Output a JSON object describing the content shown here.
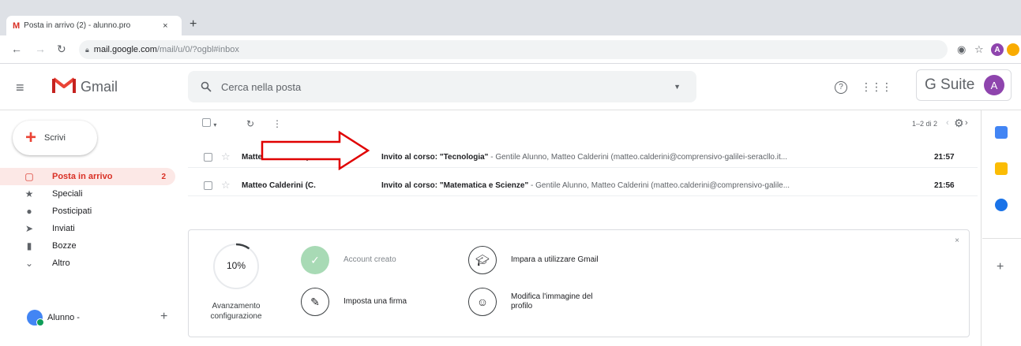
{
  "browser": {
    "tab_title": "Posta in arrivo (2) - alunno.pro",
    "tab_close": "×",
    "new_tab": "+",
    "url_host": "mail.google.com",
    "url_path": "/mail/u/0/?ogbl#inbox"
  },
  "header": {
    "app_name": "Gmail",
    "search_placeholder": "Cerca nella posta",
    "gsuite_label": "G Suite",
    "avatar_letter": "A"
  },
  "sidebar": {
    "compose_label": "Scrivi",
    "items": [
      {
        "label": "Posta in arrivo",
        "count": "2",
        "icon": "inbox-icon"
      },
      {
        "label": "Speciali",
        "icon": "star-icon"
      },
      {
        "label": "Posticipati",
        "icon": "clock-icon"
      },
      {
        "label": "Inviati",
        "icon": "send-icon"
      },
      {
        "label": "Bozze",
        "icon": "draft-icon"
      },
      {
        "label": "Altro",
        "icon": "chevron-down-icon"
      }
    ],
    "user_label": "Alunno -",
    "user_add": "+"
  },
  "list": {
    "pager": "1–2 di 2",
    "emails": [
      {
        "sender": "Matteo Calderini (C.",
        "subject": "Invito al corso: \"Tecnologia\"",
        "snippet": " - Gentile Alunno, Matteo Calderini (matteo.calderini@comprensivo-galilei-seracllo.it...",
        "time": "21:57"
      },
      {
        "sender": "Matteo Calderini (C.",
        "subject": "Invito al corso: \"Matematica e Scienze\"",
        "snippet": " - Gentile Alunno, Matteo Calderini (matteo.calderini@comprensivo-galile...",
        "time": "21:56"
      }
    ]
  },
  "setup": {
    "percent": "10%",
    "progress_value": 0.1,
    "progress_label": "Avanzamento configurazione",
    "tasks": [
      {
        "label": "Account creato",
        "done": true
      },
      {
        "label": "Imposta una firma",
        "done": false
      },
      {
        "label": "Impara a utilizzare Gmail",
        "done": false
      },
      {
        "label": "Modifica l'immagine del profilo",
        "done": false
      }
    ],
    "close": "×"
  },
  "colors": {
    "accent_red": "#d93025",
    "arrow_red": "#e00000",
    "active_bg": "#fce8e6"
  }
}
